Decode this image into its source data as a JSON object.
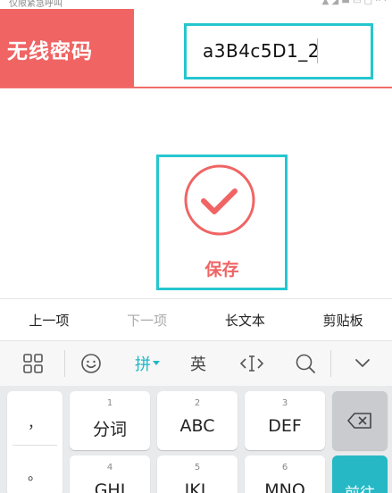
{
  "status_bar": {
    "left_text": "仅限紧急呼叫",
    "right_text": "▲ ◢ ▬ ▭ ▢ ·· ·"
  },
  "password": {
    "label": "无线密码",
    "value": "a3B4c5D1_2"
  },
  "save": {
    "label": "保存"
  },
  "toolbar": {
    "prev": "上一项",
    "next": "下一项",
    "long_text": "长文本",
    "clipboard": "剪贴板"
  },
  "ime": {
    "pinyin": "拼",
    "english": "英"
  },
  "keyboard": {
    "sym_top": "，",
    "sym_bottom": "。",
    "keys_row1": [
      {
        "num": "1",
        "label": "分词"
      },
      {
        "num": "2",
        "label": "ABC"
      },
      {
        "num": "3",
        "label": "DEF"
      }
    ],
    "keys_row2": [
      {
        "num": "4",
        "label": "GHI"
      },
      {
        "num": "5",
        "label": "JKL"
      },
      {
        "num": "6",
        "label": "MNO"
      }
    ],
    "go_label": "前往"
  },
  "colors": {
    "accent_red": "#f06464",
    "accent_cyan": "#26c6cf"
  }
}
